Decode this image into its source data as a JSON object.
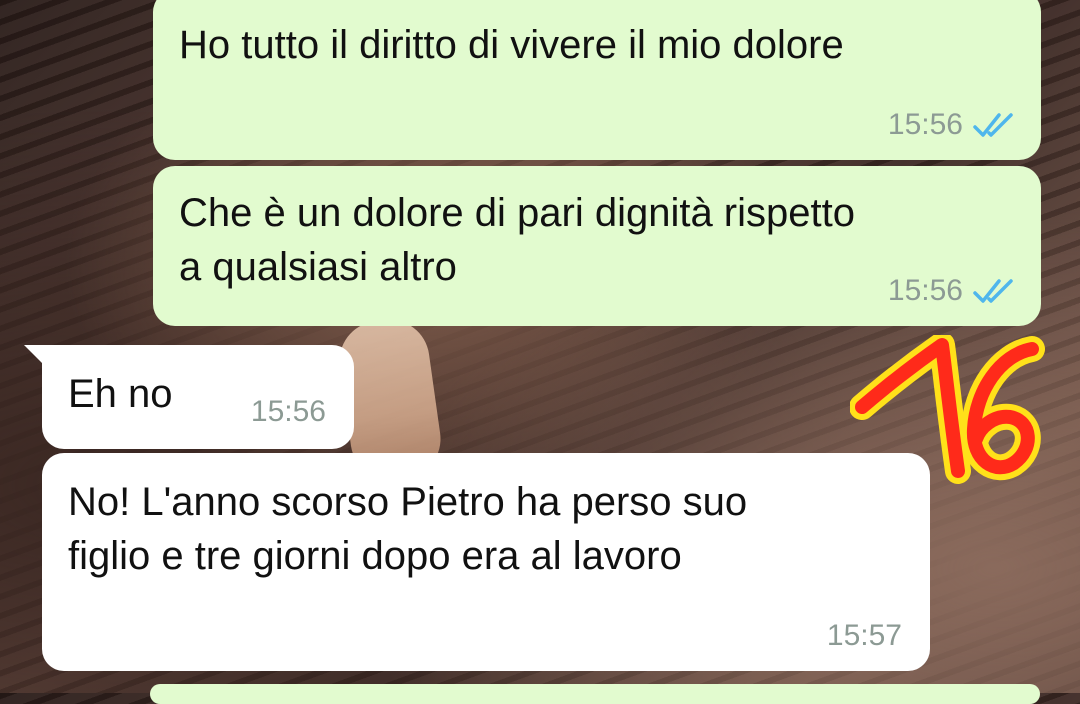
{
  "colors": {
    "outgoing_bubble": "#e2fbcf",
    "incoming_bubble": "#ffffff",
    "read_tick": "#4fb6ec",
    "timestamp": "#8c9a94",
    "sticker_fill": "#ff2a1a",
    "sticker_stroke": "#ffe11a"
  },
  "messages": [
    {
      "direction": "outgoing",
      "text": "Ho tutto il diritto di vivere il mio dolore",
      "time": "15:56",
      "status_icon": "double-check-read-icon"
    },
    {
      "direction": "outgoing",
      "text": "Che è un dolore di pari dignità rispetto\na qualsiasi altro",
      "time": "15:56",
      "status_icon": "double-check-read-icon"
    },
    {
      "direction": "incoming",
      "text": "Eh no",
      "time": "15:56"
    },
    {
      "direction": "incoming",
      "text": "No! L'anno scorso Pietro ha perso suo\nfiglio e tre giorni dopo era al lavoro",
      "time": "15:57"
    }
  ],
  "overlay": {
    "label": "16",
    "icon": "handwritten-number-sticker"
  }
}
